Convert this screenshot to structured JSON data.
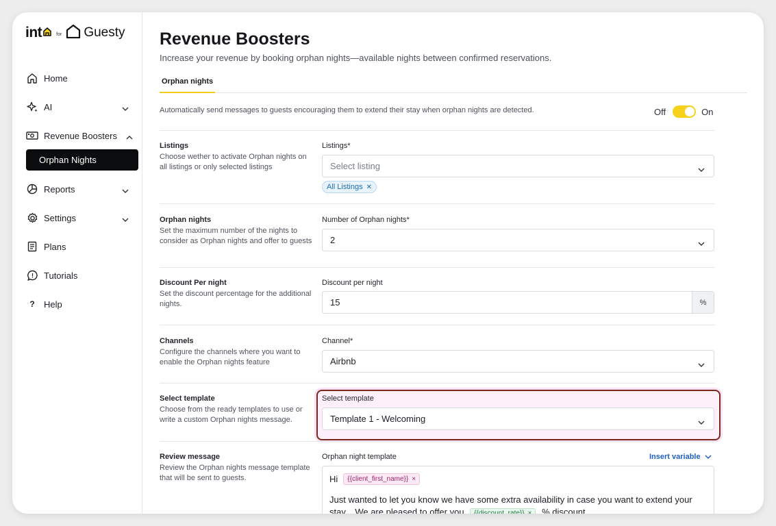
{
  "brand": {
    "into": "int",
    "for": "for",
    "guesty": "Guesty"
  },
  "sidebar": {
    "items": [
      {
        "label": "Home",
        "icon": "home-icon"
      },
      {
        "label": "AI",
        "icon": "sparkle-icon"
      },
      {
        "label": "Revenue Boosters",
        "icon": "money-icon"
      },
      {
        "label": "Reports",
        "icon": "pie-chart-icon"
      },
      {
        "label": "Settings",
        "icon": "gear-icon"
      },
      {
        "label": "Plans",
        "icon": "clipboard-icon"
      },
      {
        "label": "Tutorials",
        "icon": "help-chat-icon"
      },
      {
        "label": "Help",
        "icon": "question-icon"
      }
    ],
    "active_sub": "Orphan Nights"
  },
  "page": {
    "title": "Revenue Boosters",
    "subtitle": "Increase your revenue by booking orphan nights—available nights between confirmed reservations.",
    "tab": "Orphan nights",
    "auto_text": "Automatically send messages to guests encouraging them to extend their stay when orphan nights are detected.",
    "toggle_off": "Off",
    "toggle_on": "On",
    "toggle_state": "on"
  },
  "sections": {
    "listings": {
      "title": "Listings",
      "desc": "Choose wether to activate Orphan nights on all listings or only selected listings",
      "field_label": "Listings*",
      "placeholder": "Select listing",
      "chip": "All Listings"
    },
    "orphan": {
      "title": "Orphan nights",
      "desc": "Set the maximum number of the nights to consider as Orphan nights and offer to guests",
      "field_label": "Number of Orphan nights*",
      "value": "2"
    },
    "discount": {
      "title": "Discount Per night",
      "desc": "Set the discount percentage for the additional nights.",
      "field_label": "Discount per night",
      "value": "15",
      "suffix": "%"
    },
    "channels": {
      "title": "Channels",
      "desc": "Configure the channels where you want to enable the Orphan nights feature",
      "field_label": "Channel*",
      "value": "Airbnb"
    },
    "template": {
      "title": "Select template",
      "desc": "Choose from the ready templates to use or write a custom Orphan nights message.",
      "field_label": "Select template",
      "value": "Template 1 - Welcoming"
    },
    "review": {
      "title": "Review message",
      "desc": "Review the Orphan nights message template that will be sent to guests.",
      "field_label": "Orphan night template",
      "insert_variable": "Insert variable",
      "greeting": "Hi",
      "var1": "{{client_first_name}}",
      "body_start": "Just wanted to let you know we have some extra availability in case you want to extend your stay... We are pleased to offer you",
      "var2": "{{discount_rate}}",
      "body_end": "% discount"
    }
  },
  "colors": {
    "accent": "#f6d21c",
    "link": "#1f5fc2",
    "highlight_border": "#7a2a1c"
  }
}
